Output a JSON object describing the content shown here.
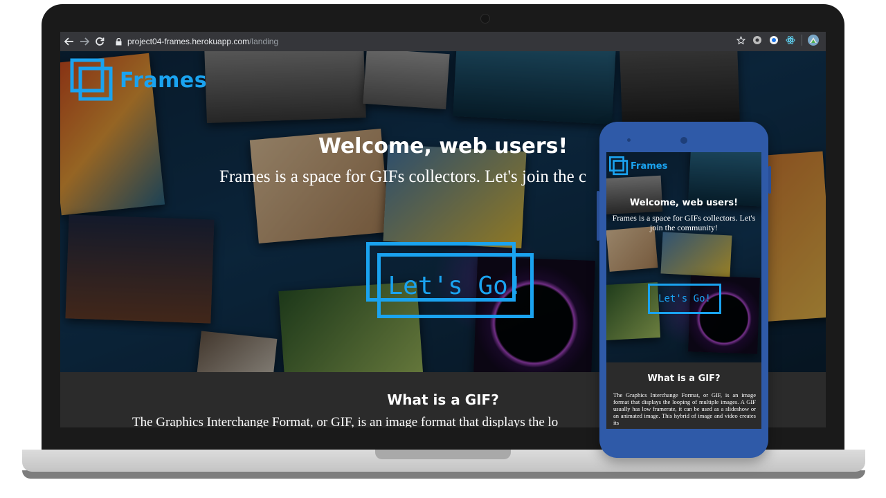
{
  "browser": {
    "url_host": "project04-frames.herokuapp.com",
    "url_path": "/landing",
    "icons": [
      "back-arrow-icon",
      "forward-arrow-icon",
      "reload-icon",
      "lock-icon",
      "star-icon",
      "extension-icon",
      "extension-icon",
      "react-icon",
      "profile-avatar-icon"
    ]
  },
  "site": {
    "brand": "Frames",
    "hero_title": "Welcome, web users!",
    "hero_subtitle_visible": "Frames is a space for GIFs collectors. Let's join the c",
    "cta_label": "Let's Go!",
    "info_title": "What is a GIF?",
    "info_body_visible": "The Graphics Interchange Format, or GIF, is an image format that displays the lo"
  },
  "phone": {
    "brand": "Frames",
    "hero_title": "Welcome, web users!",
    "hero_subtitle": "Frames is a space for GIFs collectors. Let's join the community!",
    "cta_label": "Let's Go!",
    "info_title": "What is a GIF?",
    "info_body": "The Graphics Interchange Format, or GIF, is an image format that displays the looping of multiple images. A GIF usually has low framerate, it can be used as a slideshow or an animated image. This hybrid of image and video creates its"
  },
  "colors": {
    "accent": "#1aa3f0",
    "phone_body": "#2f5aa8",
    "browser_toolbar": "#35363a"
  }
}
